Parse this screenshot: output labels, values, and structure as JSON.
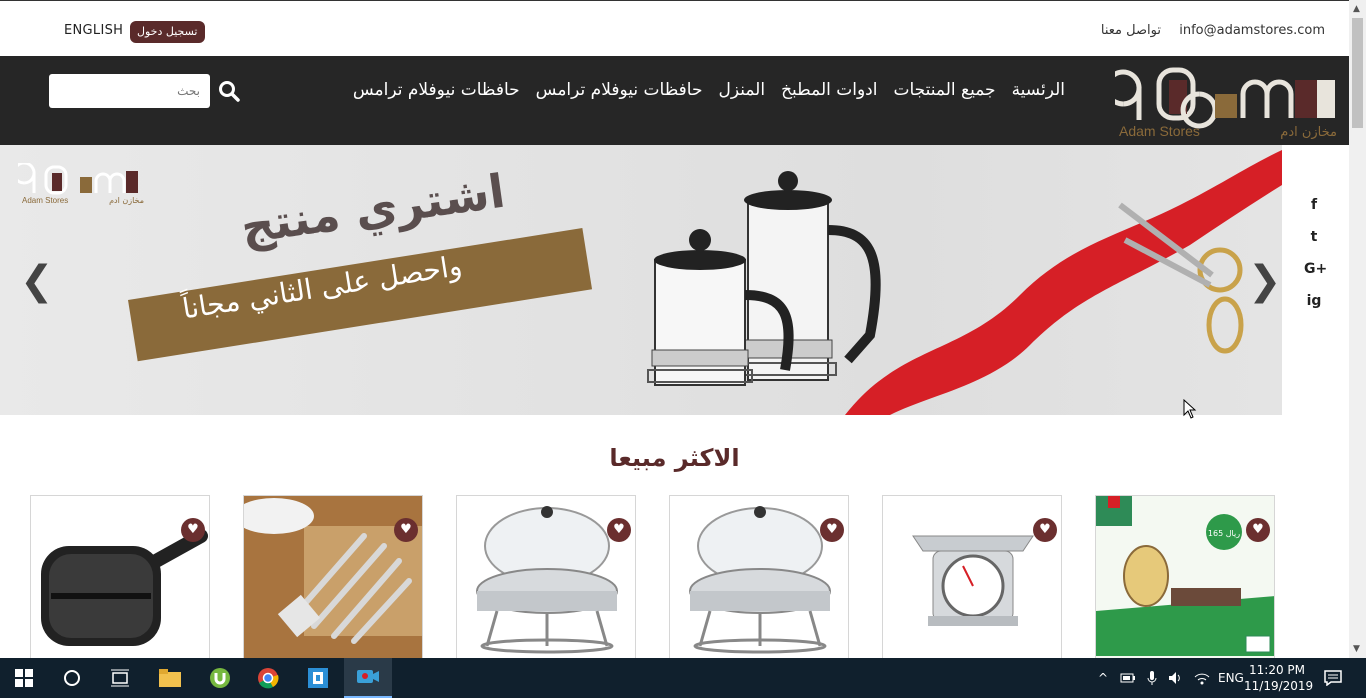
{
  "topbar": {
    "email": "info@adamstores.com",
    "contact": "تواصل معنا",
    "language": "ENGLISH",
    "login": "تسجيل دخول"
  },
  "brand": {
    "logo_text": "adam",
    "name_en": "Adam Stores",
    "name_ar": "مخازن ادم"
  },
  "nav": {
    "items": [
      "الرئسية",
      "جميع المنتجات",
      "ادوات المطبخ",
      "المنزل",
      "حافظات نيوفلام ترامس",
      "حافظات نيوفلام ترامس"
    ],
    "search_placeholder": "بحث"
  },
  "hero": {
    "title": "اشتري منتج",
    "subtitle": "واحصل على الثاني مجاناً",
    "logo_text": "adam",
    "logo_en": "Adam Stores",
    "logo_ar": "مخازن ادم"
  },
  "social": [
    "f",
    "t",
    "G+",
    "ig"
  ],
  "section": {
    "title": "الاكثر مبيعا",
    "price_badge": "165 ريال"
  },
  "taskbar": {
    "lang": "ENG",
    "time": "11:20 PM",
    "date": "11/19/2019"
  },
  "colors": {
    "nav_bg": "#262626",
    "accent": "#5a2a2a",
    "banner": "#8a6a3a",
    "ribbon": "#d61f26"
  }
}
